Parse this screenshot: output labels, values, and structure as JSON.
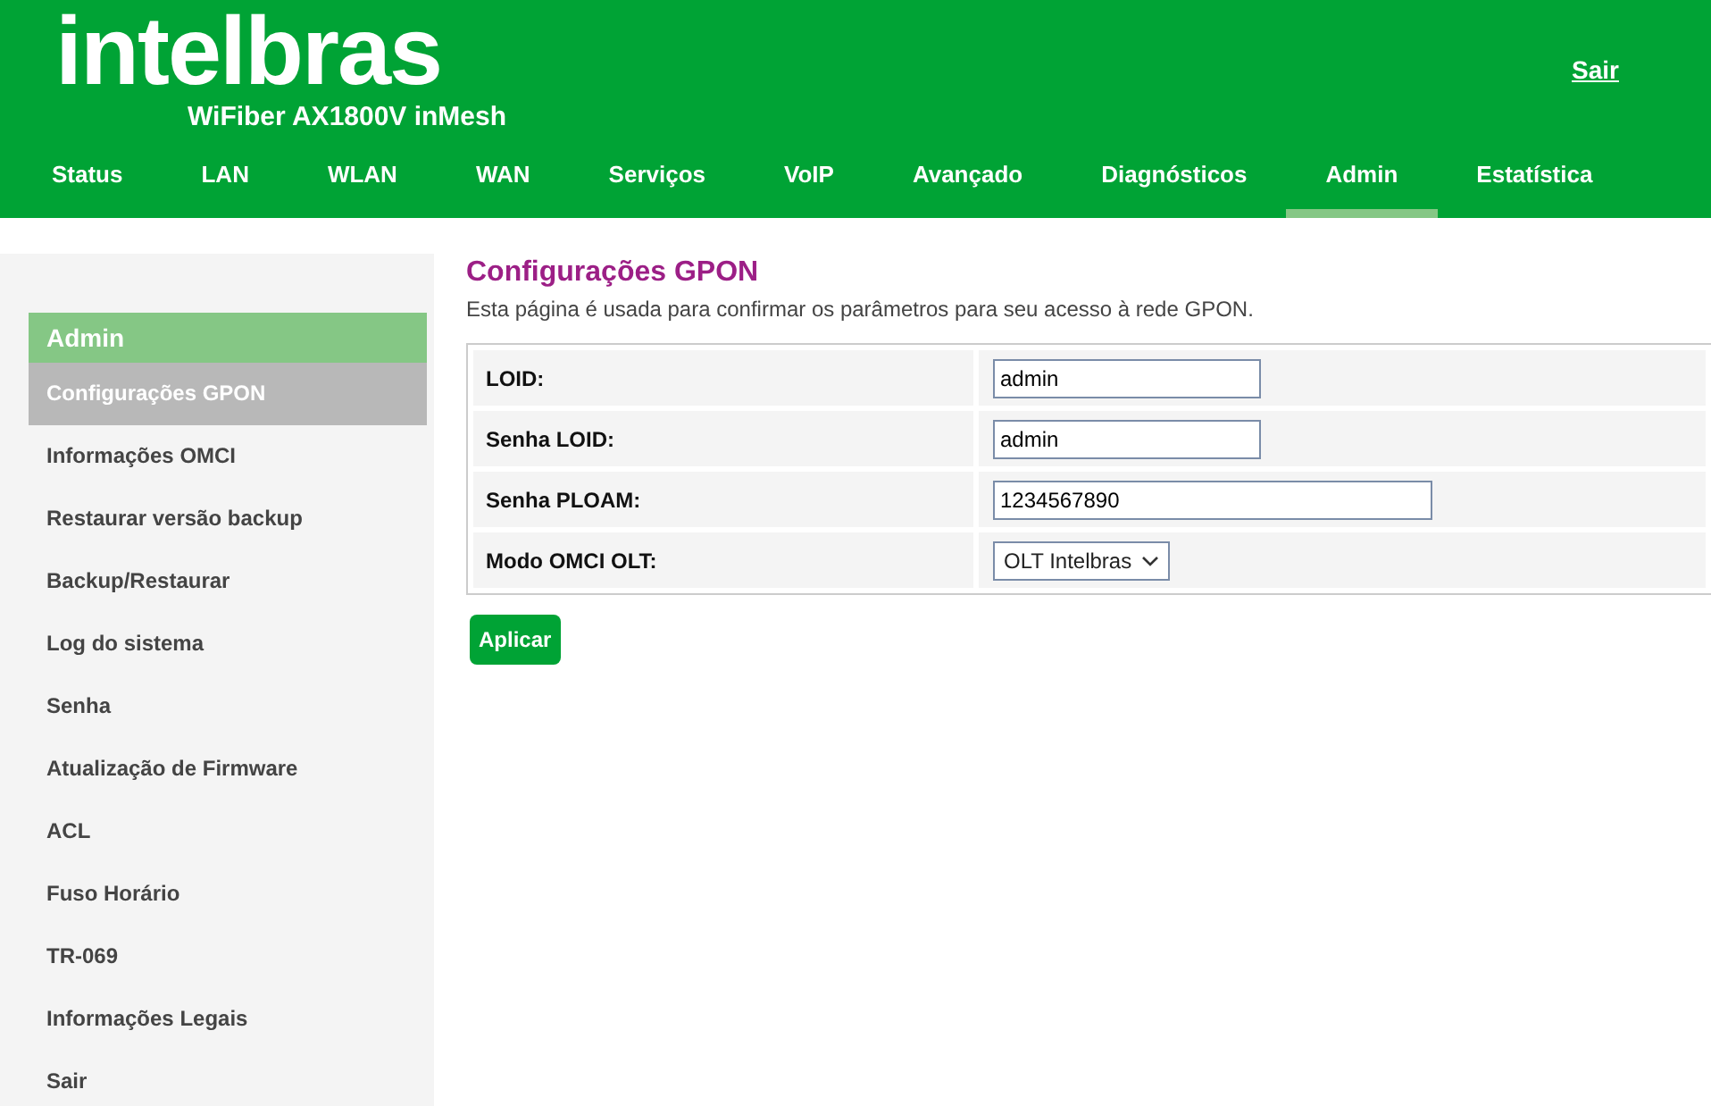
{
  "header": {
    "logo": "intelbras",
    "model": "WiFiber AX1800V inMesh",
    "logout": "Sair"
  },
  "tabs": [
    {
      "label": "Status",
      "selected": false
    },
    {
      "label": "LAN",
      "selected": false
    },
    {
      "label": "WLAN",
      "selected": false
    },
    {
      "label": "WAN",
      "selected": false
    },
    {
      "label": "Serviços",
      "selected": false
    },
    {
      "label": "VoIP",
      "selected": false
    },
    {
      "label": "Avançado",
      "selected": false
    },
    {
      "label": "Diagnósticos",
      "selected": false
    },
    {
      "label": "Admin",
      "selected": true
    },
    {
      "label": "Estatística",
      "selected": false
    }
  ],
  "sidebar": {
    "title": "Admin",
    "items": [
      {
        "label": "Configurações GPON",
        "selected": true
      },
      {
        "label": "Informações OMCI",
        "selected": false
      },
      {
        "label": "Restaurar versão backup",
        "selected": false
      },
      {
        "label": "Backup/Restaurar",
        "selected": false
      },
      {
        "label": "Log do sistema",
        "selected": false
      },
      {
        "label": "Senha",
        "selected": false
      },
      {
        "label": "Atualização de Firmware",
        "selected": false
      },
      {
        "label": "ACL",
        "selected": false
      },
      {
        "label": "Fuso Horário",
        "selected": false
      },
      {
        "label": "TR-069",
        "selected": false
      },
      {
        "label": "Informações Legais",
        "selected": false
      },
      {
        "label": "Sair",
        "selected": false
      }
    ]
  },
  "page": {
    "title": "Configurações GPON",
    "description": "Esta página é usada para confirmar os parâmetros para seu acesso à rede GPON."
  },
  "form": [
    {
      "label": "LOID:",
      "kind": "text",
      "value": "admin"
    },
    {
      "label": "Senha LOID:",
      "kind": "text",
      "value": "admin"
    },
    {
      "label": "Senha PLOAM:",
      "kind": "wide-text",
      "value": "1234567890"
    },
    {
      "label": "Modo OMCI OLT:",
      "kind": "select",
      "value": "OLT Intelbras"
    }
  ],
  "buttons": [
    "Aplicar"
  ]
}
